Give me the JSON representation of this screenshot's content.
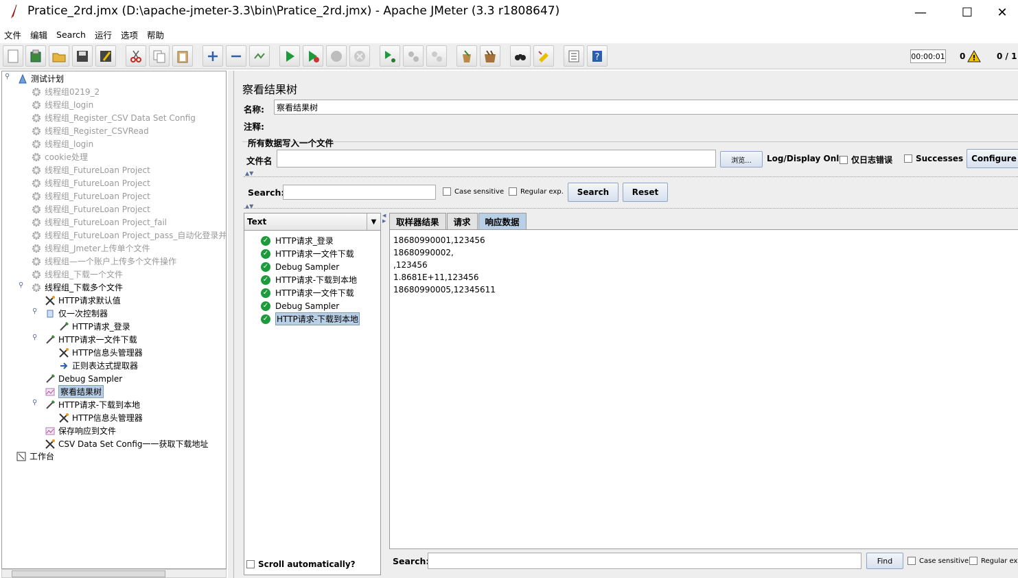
{
  "window": {
    "title": "Pratice_2rd.jmx (D:\\apache-jmeter-3.3\\bin\\Pratice_2rd.jmx) - Apache JMeter (3.3 r1808647)",
    "minimize": "—",
    "maximize": "☐",
    "close": "✕"
  },
  "menu": [
    "文件",
    "编辑",
    "Search",
    "运行",
    "选项",
    "帮助"
  ],
  "toolbar": {
    "timer": "00:00:01",
    "warning_count": "0",
    "threads": "0 / 1"
  },
  "tree": [
    {
      "label": "测试计划",
      "disabled": false,
      "icon": "test-plan-icon"
    },
    {
      "label": "线程组0219_2",
      "disabled": true,
      "icon": "gear-icon"
    },
    {
      "label": "线程组_login",
      "disabled": true,
      "icon": "gear-icon"
    },
    {
      "label": "线程组_Register_CSV Data Set Config",
      "disabled": true,
      "icon": "gear-icon"
    },
    {
      "label": "线程组_Register_CSVRead",
      "disabled": true,
      "icon": "gear-icon"
    },
    {
      "label": "线程组_login",
      "disabled": true,
      "icon": "gear-icon"
    },
    {
      "label": "cookie处理",
      "disabled": true,
      "icon": "gear-icon"
    },
    {
      "label": "线程组_FutureLoan Project",
      "disabled": true,
      "icon": "gear-icon"
    },
    {
      "label": "线程组_FutureLoan Project",
      "disabled": true,
      "icon": "gear-icon"
    },
    {
      "label": "线程组_FutureLoan Project",
      "disabled": true,
      "icon": "gear-icon"
    },
    {
      "label": "线程组_FutureLoan Project",
      "disabled": true,
      "icon": "gear-icon"
    },
    {
      "label": "线程组_FutureLoan Project_fail",
      "disabled": true,
      "icon": "gear-icon"
    },
    {
      "label": "线程组_FutureLoan Project_pass_自动化登录并上传",
      "disabled": true,
      "icon": "gear-icon"
    },
    {
      "label": "线程组_Jmeter上传单个文件",
      "disabled": true,
      "icon": "gear-icon"
    },
    {
      "label": "线程组—一个账户上传多个文件操作",
      "disabled": true,
      "icon": "gear-icon"
    },
    {
      "label": "线程组_下载一个文件",
      "disabled": true,
      "icon": "gear-icon"
    },
    {
      "label": "线程组_下载多个文件",
      "disabled": false,
      "icon": "gear-icon"
    },
    {
      "label": "HTTP请求默认值",
      "disabled": false,
      "icon": "wrench-icon"
    },
    {
      "label": "仅一次控制器",
      "disabled": false,
      "icon": "controller-icon"
    },
    {
      "label": "HTTP请求_登录",
      "disabled": false,
      "icon": "pipette-icon"
    },
    {
      "label": "HTTP请求一文件下载",
      "disabled": false,
      "icon": "pipette-icon"
    },
    {
      "label": "HTTP信息头管理器",
      "disabled": false,
      "icon": "wrench-icon"
    },
    {
      "label": "正则表达式提取器",
      "disabled": false,
      "icon": "extractor-icon"
    },
    {
      "label": "Debug Sampler",
      "disabled": false,
      "icon": "pipette-icon"
    },
    {
      "label": "察看结果树",
      "disabled": false,
      "icon": "listener-icon",
      "selected": true
    },
    {
      "label": "HTTP请求-下载到本地",
      "disabled": false,
      "icon": "pipette-icon"
    },
    {
      "label": "HTTP信息头管理器",
      "disabled": false,
      "icon": "wrench-icon"
    },
    {
      "label": "保存响应到文件",
      "disabled": false,
      "icon": "listener-icon"
    },
    {
      "label": "CSV Data Set Config一一获取下载地址",
      "disabled": false,
      "icon": "wrench-icon"
    },
    {
      "label": "工作台",
      "disabled": false,
      "icon": "workbench-icon"
    }
  ],
  "panel": {
    "title": "察看结果树",
    "name_label": "名称:",
    "name_value": "察看结果树",
    "comment_label": "注释:",
    "group_title": "所有数据写入一个文件",
    "file_label": "文件名",
    "browse": "浏览...",
    "log_display": "Log/Display Only:",
    "errors_only": "仅日志错误",
    "successes": "Successes",
    "configure": "Configure",
    "search_label": "Search:",
    "case_sensitive": "Case sensitive",
    "regular_exp": "Regular exp.",
    "search_btn": "Search",
    "reset_btn": "Reset",
    "renderer": "Text",
    "scroll_auto": "Scroll automatically?",
    "tabs": [
      "取样器结果",
      "请求",
      "响应数据"
    ],
    "bottom_search_label": "Search:",
    "find": "Find",
    "bottom_case": "Case sensitive",
    "bottom_regex": "Regular exp."
  },
  "results": [
    {
      "label": "HTTP请求_登录"
    },
    {
      "label": "HTTP请求一文件下载"
    },
    {
      "label": "Debug Sampler"
    },
    {
      "label": "HTTP请求-下载到本地"
    },
    {
      "label": "HTTP请求一文件下载"
    },
    {
      "label": "Debug Sampler"
    },
    {
      "label": "HTTP请求-下载到本地",
      "selected": true
    }
  ],
  "response_lines": [
    "18680990001,123456",
    "18680990002,",
    ",123456",
    "1.8681E+11,123456",
    "18680990005,12345611"
  ]
}
